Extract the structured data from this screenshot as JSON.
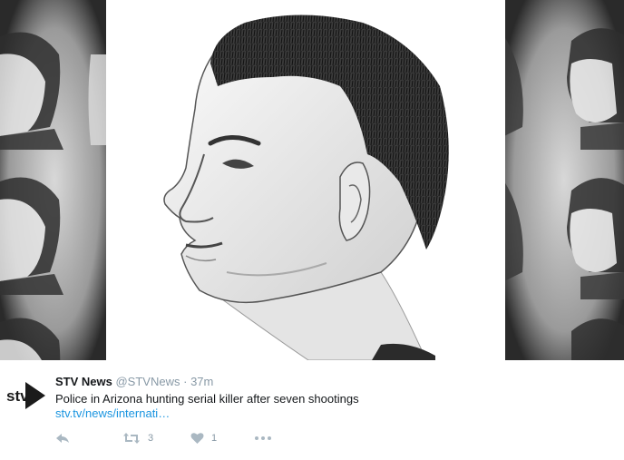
{
  "tweet": {
    "author_name": "STV News",
    "author_handle": "@STVNews",
    "separator": "·",
    "time_ago": "37m",
    "text": "Police in Arizona hunting serial killer after seven shootings",
    "link_text": "stv.tv/news/internati…",
    "logo_text": "stv",
    "actions": {
      "reply_icon": "reply-icon",
      "retweet_icon": "retweet-icon",
      "retweet_count": "3",
      "like_icon": "heart-icon",
      "like_count": "1",
      "more_icon": "more-dots-icon"
    }
  },
  "media": {
    "description_icon": "suspect-sketch-image"
  },
  "colors": {
    "link": "#1b95e0",
    "muted": "#8899a6",
    "icon": "#aab8c2",
    "text": "#14171a"
  }
}
